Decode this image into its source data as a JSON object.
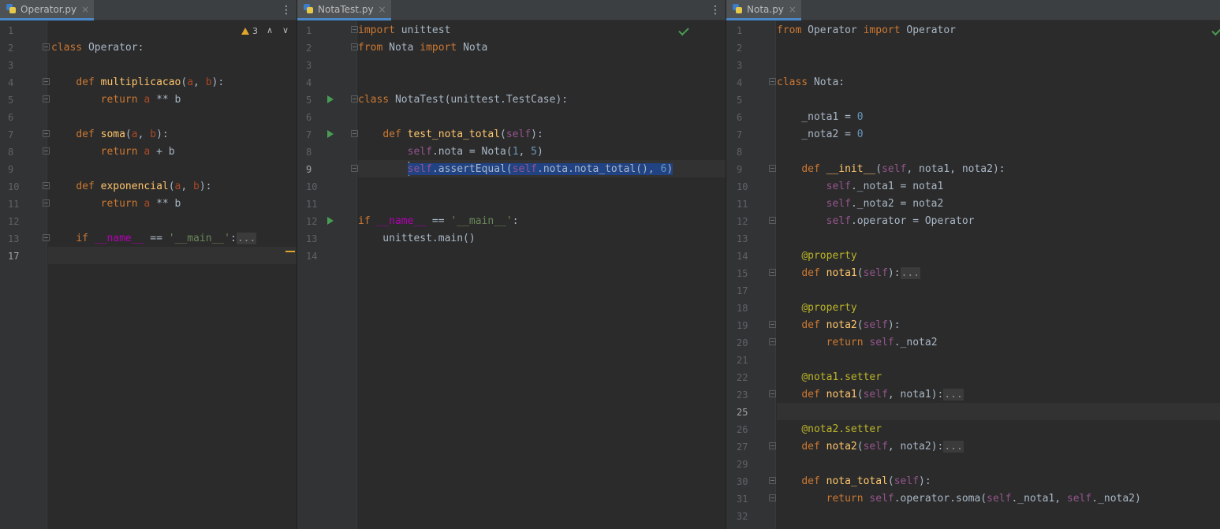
{
  "panes": [
    {
      "tab": {
        "label": "Operator.py",
        "close": "×"
      },
      "menu": "⋮",
      "inspections": {
        "warning_count": "3",
        "up": "∧",
        "down": "∨"
      },
      "lines": [
        {
          "n": "1",
          "t": ""
        },
        {
          "n": "2",
          "t": "class Operator:"
        },
        {
          "n": "3",
          "t": ""
        },
        {
          "n": "4",
          "t": "    def multiplicacao(a, b):"
        },
        {
          "n": "5",
          "t": "        return a ** b"
        },
        {
          "n": "6",
          "t": ""
        },
        {
          "n": "7",
          "t": "    def soma(a, b):"
        },
        {
          "n": "8",
          "t": "        return a + b"
        },
        {
          "n": "9",
          "t": ""
        },
        {
          "n": "10",
          "t": "    def exponencial(a, b):"
        },
        {
          "n": "11",
          "t": "        return a ** b"
        },
        {
          "n": "12",
          "t": ""
        },
        {
          "n": "13",
          "t": "    if __name__ == '__main__':..."
        },
        {
          "n": "17",
          "t": ""
        }
      ]
    },
    {
      "tab": {
        "label": "NotaTest.py",
        "close": "×"
      },
      "menu": "⋮",
      "lines": [
        {
          "n": "1",
          "t": "import unittest"
        },
        {
          "n": "2",
          "t": "from Nota import Nota"
        },
        {
          "n": "3",
          "t": ""
        },
        {
          "n": "4",
          "t": ""
        },
        {
          "n": "5",
          "t": "class NotaTest(unittest.TestCase):"
        },
        {
          "n": "6",
          "t": ""
        },
        {
          "n": "7",
          "t": "    def test_nota_total(self):"
        },
        {
          "n": "8",
          "t": "        self.nota = Nota(1, 5)"
        },
        {
          "n": "9",
          "t": "        self.assertEqual(self.nota.nota_total(), 6)"
        },
        {
          "n": "10",
          "t": ""
        },
        {
          "n": "11",
          "t": ""
        },
        {
          "n": "12",
          "t": "if __name__ == '__main__':"
        },
        {
          "n": "13",
          "t": "    unittest.main()"
        },
        {
          "n": "14",
          "t": ""
        }
      ]
    },
    {
      "tab": {
        "label": "Nota.py",
        "close": "×"
      },
      "lines": [
        {
          "n": "1",
          "t": "from Operator import Operator"
        },
        {
          "n": "2",
          "t": ""
        },
        {
          "n": "3",
          "t": ""
        },
        {
          "n": "4",
          "t": "class Nota:"
        },
        {
          "n": "5",
          "t": ""
        },
        {
          "n": "6",
          "t": "    _nota1 = 0"
        },
        {
          "n": "7",
          "t": "    _nota2 = 0"
        },
        {
          "n": "8",
          "t": ""
        },
        {
          "n": "9",
          "t": "    def __init__(self, nota1, nota2):"
        },
        {
          "n": "10",
          "t": "        self._nota1 = nota1"
        },
        {
          "n": "11",
          "t": "        self._nota2 = nota2"
        },
        {
          "n": "12",
          "t": "        self.operator = Operator"
        },
        {
          "n": "13",
          "t": ""
        },
        {
          "n": "14",
          "t": "    @property"
        },
        {
          "n": "15",
          "t": "    def nota1(self):..."
        },
        {
          "n": "17",
          "t": ""
        },
        {
          "n": "18",
          "t": "    @property"
        },
        {
          "n": "19",
          "t": "    def nota2(self):"
        },
        {
          "n": "20",
          "t": "        return self._nota2"
        },
        {
          "n": "21",
          "t": ""
        },
        {
          "n": "22",
          "t": "    @nota1.setter"
        },
        {
          "n": "23",
          "t": "    def nota1(self, nota1):..."
        },
        {
          "n": "25",
          "t": ""
        },
        {
          "n": "26",
          "t": "    @nota2.setter"
        },
        {
          "n": "27",
          "t": "    def nota2(self, nota2):..."
        },
        {
          "n": "29",
          "t": ""
        },
        {
          "n": "30",
          "t": "    def nota_total(self):"
        },
        {
          "n": "31",
          "t": "        return self.operator.soma(self._nota1, self._nota2)"
        },
        {
          "n": "32",
          "t": ""
        }
      ]
    }
  ],
  "colors": {
    "background": "#2b2b2b",
    "keyword": "#cc7832",
    "function": "#ffc66d",
    "self": "#94558d",
    "number": "#6897bb",
    "string": "#6a8759",
    "dunder": "#b200b2",
    "decorator": "#bbb529",
    "selection": "#214283"
  },
  "icons": [
    "python-file-icon",
    "close-icon",
    "more-vert-icon",
    "warning-icon",
    "run-icon",
    "bulb-icon",
    "check-icon",
    "fold-icon"
  ]
}
